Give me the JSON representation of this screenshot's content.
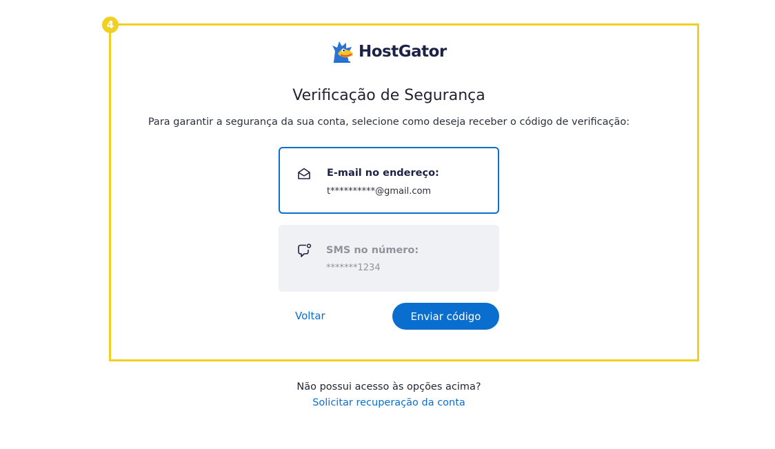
{
  "annotation": {
    "step_number": "4",
    "highlight_color": "#f2d022"
  },
  "brand": {
    "name": "HostGator",
    "logo_icon": "gator-mascot-icon",
    "text_color": "#1c2245"
  },
  "page": {
    "title": "Verificação de Segurança",
    "subtitle": "Para garantir a segurança da sua conta, selecione como deseja receber o código de verificação:"
  },
  "options": {
    "email": {
      "icon": "envelope-icon",
      "label": "E-mail no endereço:",
      "value": "t**********@gmail.com",
      "selected": true
    },
    "sms": {
      "icon": "chat-bubble-icon",
      "label": "SMS no número:",
      "value": "*******1234",
      "selected": false
    }
  },
  "actions": {
    "back_label": "Voltar",
    "send_label": "Enviar código"
  },
  "footer": {
    "question": "Não possui acesso às opções acima?",
    "recovery_link": "Solicitar recuperação da conta"
  },
  "colors": {
    "accent": "#0a6ecf",
    "disabled_text": "#8f939c",
    "disabled_bg": "#f0f1f4"
  }
}
